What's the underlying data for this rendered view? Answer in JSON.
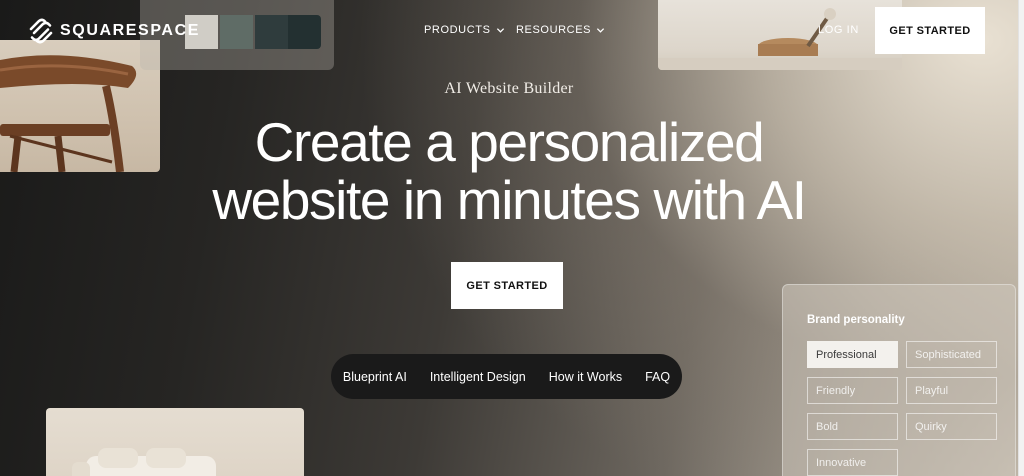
{
  "brand": {
    "logo_text": "SQUARESPACE"
  },
  "nav": {
    "products": "PRODUCTS",
    "resources": "RESOURCES",
    "login": "LOG IN",
    "get_started": "GET STARTED"
  },
  "hero": {
    "eyebrow": "AI Website Builder",
    "headline_line1": "Create a personalized",
    "headline_line2": "website in minutes with AI",
    "cta": "GET STARTED"
  },
  "pill_nav": {
    "items": [
      "Blueprint AI",
      "Intelligent Design",
      "How it Works",
      "FAQ"
    ]
  },
  "brand_personality": {
    "title": "Brand personality",
    "options": [
      "Professional",
      "Sophisticated",
      "Friendly",
      "Playful",
      "Bold",
      "Quirky",
      "Innovative"
    ],
    "selected": "Professional"
  },
  "palette": {
    "swatches": [
      "#d0cdc6",
      "#5f6c66",
      "#2f3c3d",
      "#233031"
    ]
  },
  "icons": {
    "logo": "squarespace-logo-icon",
    "dropdown": "chevron-down-icon"
  }
}
